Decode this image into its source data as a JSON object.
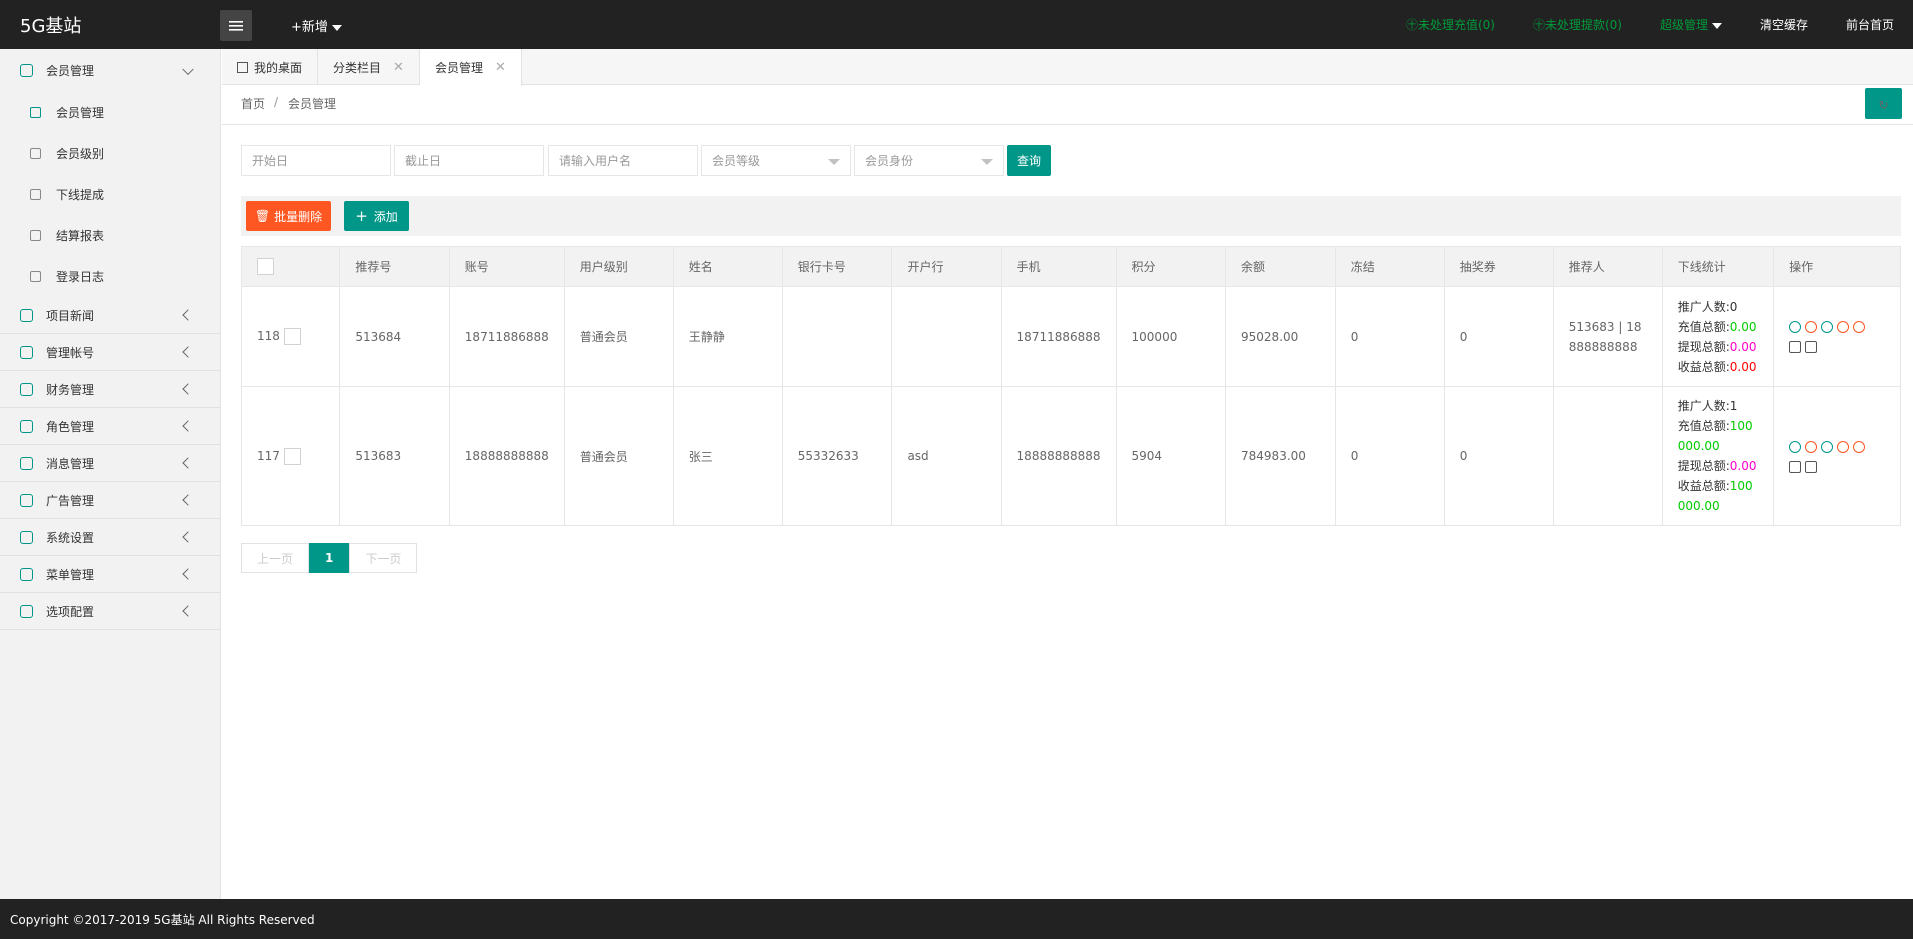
{
  "app": {
    "logo": "5G基站",
    "add_new": "+新增"
  },
  "header_right": {
    "recharge": "㊉未处理充值(0)",
    "withdraw": "㊉未处理提款(0)",
    "admin": "超级管理",
    "clear_cache": "清空缓存",
    "front_home": "前台首页"
  },
  "sidebar": {
    "member_mgmt": "会员管理",
    "subitems": [
      "会员管理",
      "会员级别",
      "下线提成",
      "结算报表",
      "登录日志"
    ],
    "items": [
      "项目新闻",
      "管理帐号",
      "财务管理",
      "角色管理",
      "消息管理",
      "广告管理",
      "系统设置",
      "菜单管理",
      "选项配置"
    ]
  },
  "tabs": [
    "我的桌面",
    "分类栏目",
    "会员管理"
  ],
  "breadcrumb": {
    "home": "首页",
    "sep": "/",
    "current": "会员管理"
  },
  "filters": {
    "start": "开始日",
    "end": "截止日",
    "username": "请输入用户名",
    "level": "会员等级",
    "identity": "会员身份",
    "query": "查询"
  },
  "toolbar": {
    "batch_delete": "批量删除",
    "add": "添加"
  },
  "table": {
    "headers": [
      "推荐号",
      "账号",
      "用户级别",
      "姓名",
      "银行卡号",
      "开户行",
      "手机",
      "积分",
      "余额",
      "冻结",
      "抽奖券",
      "推荐人",
      "下线统计",
      "操作"
    ],
    "rows": [
      {
        "id": "118",
        "ref": "513684",
        "account": "18711886888",
        "level": "普通会员",
        "name": "王静静",
        "bank": "",
        "branch": "",
        "phone": "18711886888",
        "points": "100000",
        "balance": "95028.00",
        "frozen": "0",
        "tickets": "0",
        "referrer": "513683 | 18888888888",
        "promo": "推广人数:0",
        "recharge_label": "充值总额:",
        "recharge": "0.00",
        "withdraw_label": "提现总额:",
        "withdraw": "0.00",
        "income_label": "收益总额:",
        "income": "0.00"
      },
      {
        "id": "117",
        "ref": "513683",
        "account": "18888888888",
        "level": "普通会员",
        "name": "张三",
        "bank": "55332633",
        "branch": "asd",
        "phone": "18888888888",
        "points": "5904",
        "balance": "784983.00",
        "frozen": "0",
        "tickets": "0",
        "referrer": "",
        "promo": "推广人数:1",
        "recharge_label": "充值总额:",
        "recharge": "100000.00",
        "withdraw_label": "提现总额:",
        "withdraw": "0.00",
        "income_label": "收益总额:",
        "income": "100000.00"
      }
    ]
  },
  "pager": {
    "prev": "上一页",
    "current": "1",
    "next": "下一页"
  },
  "footer": "Copyright ©2017-2019 5G基站 All Rights Reserved"
}
